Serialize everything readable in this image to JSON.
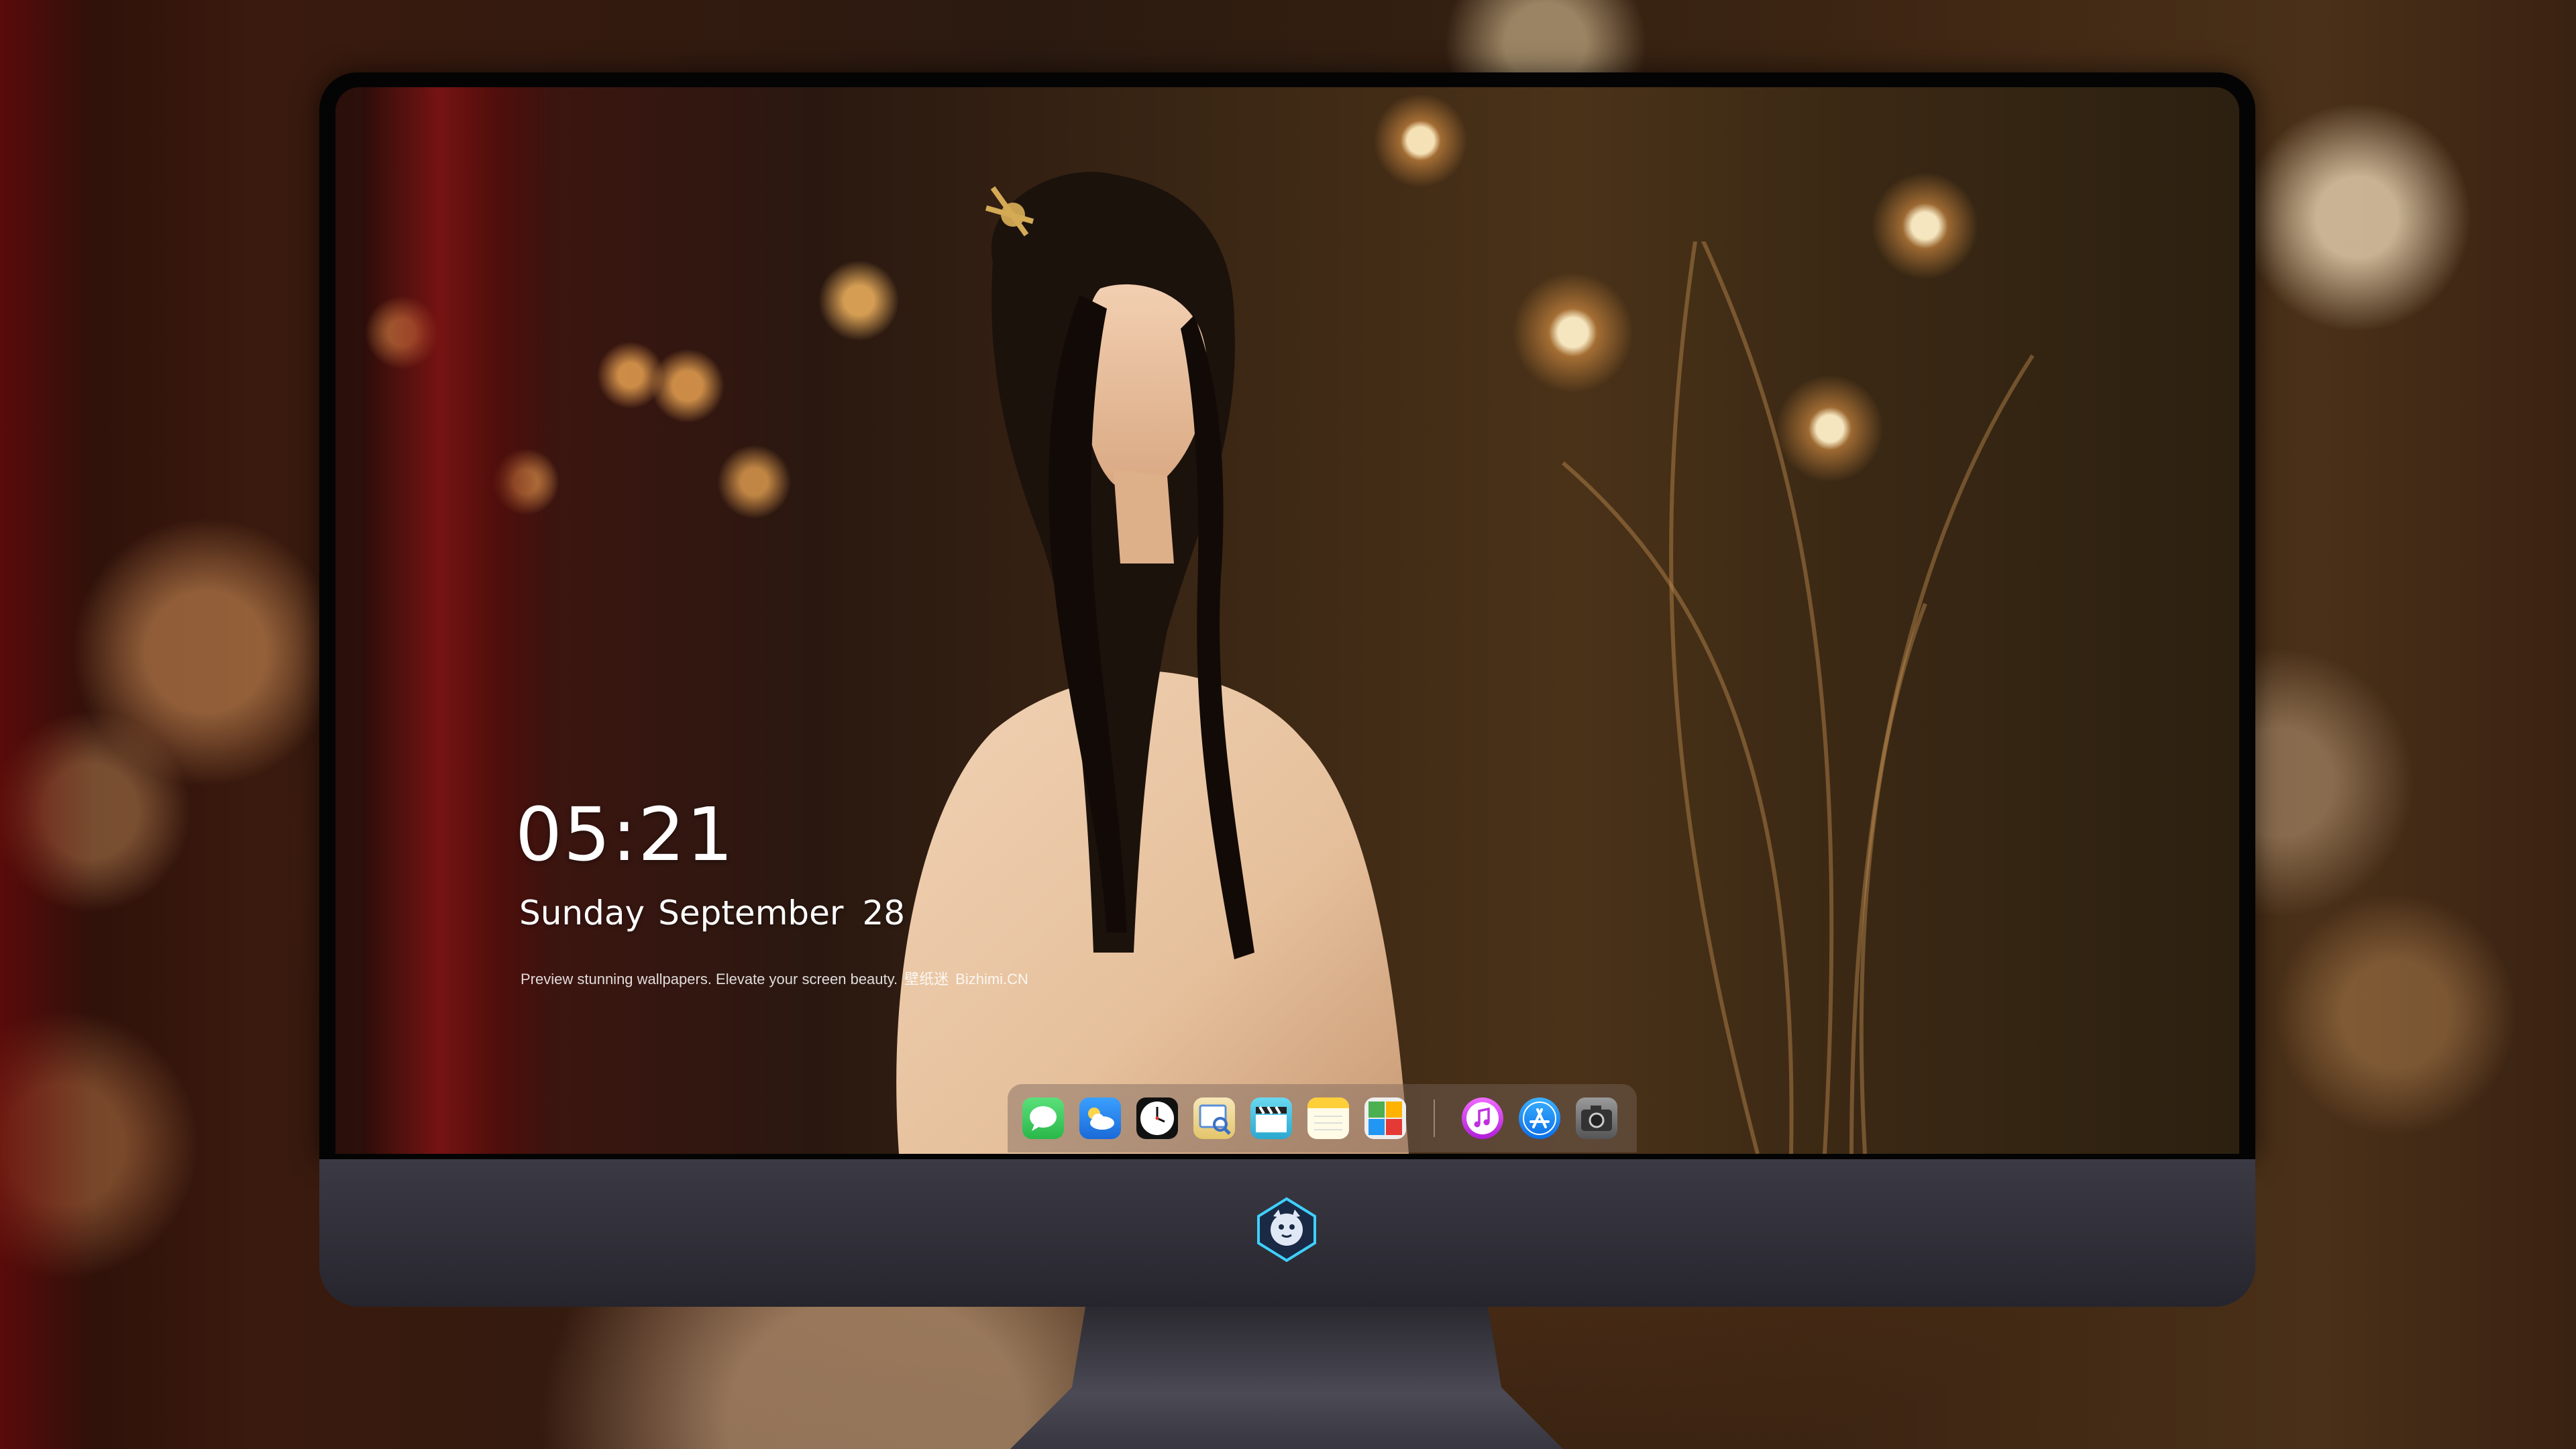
{
  "lockscreen": {
    "time": "05:21",
    "date_day": "Sunday",
    "date_month": "September",
    "date_num": "28",
    "tagline_text": "Preview stunning wallpapers. Elevate your screen beauty.",
    "tagline_cn": "壁纸迷",
    "tagline_site": "Bizhimi.CN"
  },
  "dock": {
    "icons": [
      {
        "name": "messages-icon",
        "color": "#34c759"
      },
      {
        "name": "weather-icon",
        "color": "#2f8cff"
      },
      {
        "name": "clock-icon",
        "color": "#ffffff"
      },
      {
        "name": "preview-icon",
        "color": "#f2c94c"
      },
      {
        "name": "video-icon",
        "color": "#4ec8e8"
      },
      {
        "name": "notes-icon",
        "color": "#ffd54a"
      },
      {
        "name": "photo-booth-icon",
        "color": "#5fa8ff"
      },
      {
        "name": "music-icon",
        "color": "#d63cf0"
      },
      {
        "name": "app-store-icon",
        "color": "#1c8cff"
      },
      {
        "name": "camera-icon",
        "color": "#777777"
      }
    ]
  },
  "colors": {
    "clock_text": "#ffffff",
    "monitor_chin": "#33323b",
    "bezel": "#050404"
  }
}
